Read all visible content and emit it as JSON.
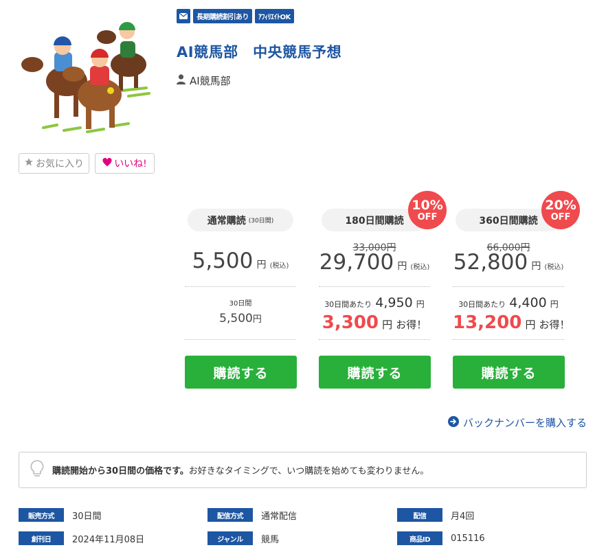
{
  "thumbnail": {
    "icon": "horse-racing-jockeys-illustration"
  },
  "actions": {
    "favorite_label": "お気に入り",
    "like_label": "いいね!"
  },
  "badges": {
    "mail_icon": "envelope-icon",
    "items": [
      "長期購読割引あり",
      "ｱﾌｨﾘｴｲﾄOK"
    ]
  },
  "title": "AI競馬部　中央競馬予想",
  "author": "AI競馬部",
  "plans": [
    {
      "head": "通常購読",
      "head_note": "(30日間)",
      "price": "5,500",
      "yen": "円",
      "tax": "(税込)",
      "per_label": "30日間",
      "per_price": "5,500",
      "per_yen": "円"
    },
    {
      "head": "180日間購読",
      "off_pct": "10%",
      "off_text": "OFF",
      "orig_price": "33,000円",
      "price": "29,700",
      "yen": "円",
      "tax": "(税込)",
      "per_label": "30日間あたり",
      "per_price": "4,950",
      "per_yen": "円",
      "save": "3,300",
      "save_yen": "円",
      "save_text": "お得！"
    },
    {
      "head": "360日間購読",
      "off_pct": "20%",
      "off_text": "OFF",
      "orig_price": "66,000円",
      "price": "52,800",
      "yen": "円",
      "tax": "(税込)",
      "per_label": "30日間あたり",
      "per_price": "4,400",
      "per_yen": "円",
      "save": "13,200",
      "save_yen": "円",
      "save_text": "お得！"
    }
  ],
  "buy_label": "購読する",
  "backnumber_label": "バックナンバーを購入する",
  "notice": {
    "bold": "購読開始から30日間の価格です。",
    "text": "お好きなタイミングで、いつ購読を始めても変わりません。"
  },
  "meta": [
    {
      "label": "販売方式",
      "value": "30日間"
    },
    {
      "label": "配信方式",
      "value": "通常配信"
    },
    {
      "label": "配信",
      "value": "月4回"
    },
    {
      "label": "創刊日",
      "value": "2024年11月08日"
    },
    {
      "label": "ジャンル",
      "value": "競馬"
    },
    {
      "label": "商品ID",
      "value": "015116"
    }
  ],
  "colors": {
    "brand": "#1d56a3",
    "buy": "#28b03a",
    "discount": "#ef4a4d",
    "like": "#e4007f"
  }
}
